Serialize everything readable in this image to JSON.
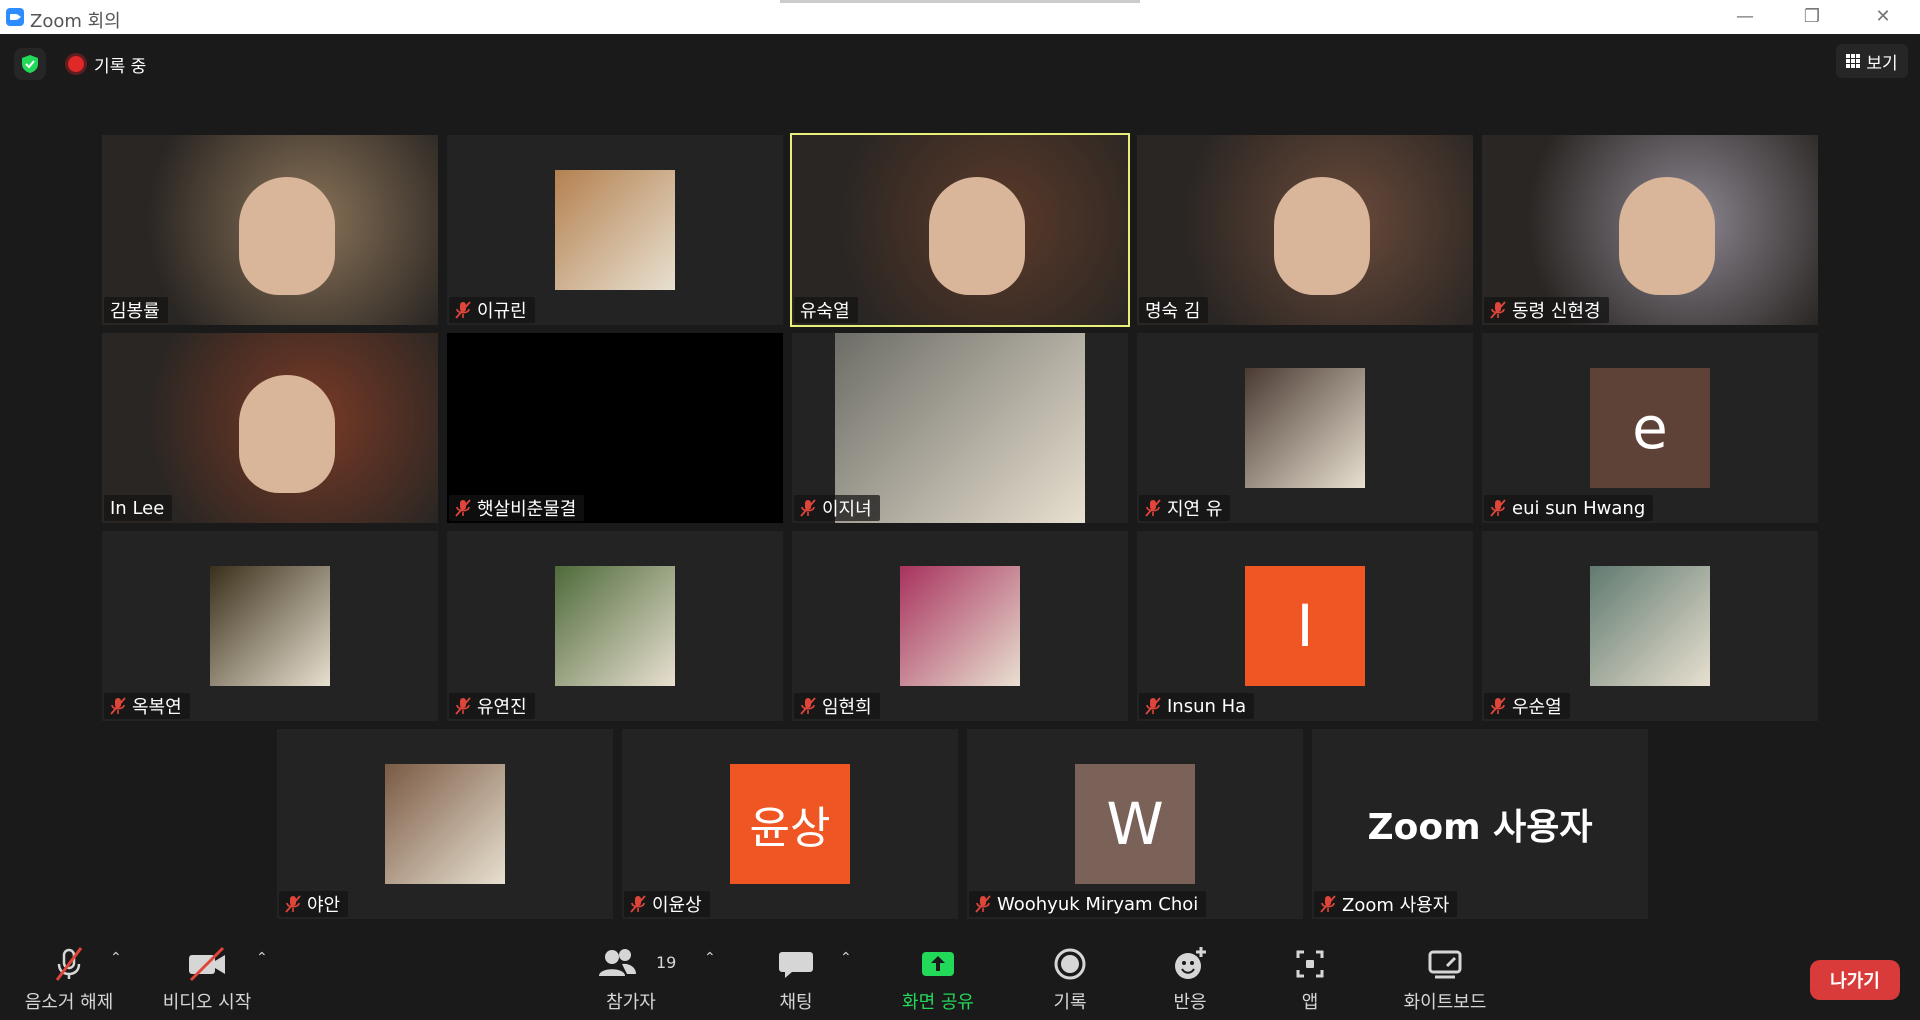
{
  "window": {
    "title": "Zoom 회의"
  },
  "top_bar": {
    "recording_label": "기록 중",
    "view_label": "보기"
  },
  "participants_count": "19",
  "tiles": [
    {
      "name": "김봉률",
      "muted": false,
      "type": "video",
      "color": "#8a7358"
    },
    {
      "name": "이규린",
      "muted": true,
      "type": "image",
      "color": "#b48150"
    },
    {
      "name": "유숙열",
      "muted": false,
      "type": "video",
      "active": true,
      "color": "#5c3a2a"
    },
    {
      "name": "명숙 김",
      "muted": false,
      "type": "video",
      "color": "#6a4a3a"
    },
    {
      "name": "동령 신현경",
      "muted": true,
      "type": "video",
      "color": "#8d8791"
    },
    {
      "name": "In Lee",
      "muted": false,
      "type": "video",
      "color": "#7a3a26"
    },
    {
      "name": "햇살비춘물결",
      "muted": true,
      "type": "black",
      "color": "#000000"
    },
    {
      "name": "이지녀",
      "muted": true,
      "type": "image",
      "color": "#6c6c66"
    },
    {
      "name": "지연 유",
      "muted": true,
      "type": "image",
      "color": "#4a3a32"
    },
    {
      "name": "eui sun Hwang",
      "muted": true,
      "type": "avatar",
      "initial": "e",
      "color": "#5e4237"
    },
    {
      "name": "옥복연",
      "muted": true,
      "type": "image",
      "color": "#3a2f1a"
    },
    {
      "name": "유연진",
      "muted": true,
      "type": "image",
      "color": "#4e6a3a"
    },
    {
      "name": "임현희",
      "muted": true,
      "type": "image",
      "color": "#a8325e"
    },
    {
      "name": "Insun Ha",
      "muted": true,
      "type": "avatar",
      "initial": "I",
      "color": "#f05623"
    },
    {
      "name": "우순열",
      "muted": true,
      "type": "image",
      "color": "#607a70"
    },
    {
      "name": "야안",
      "muted": true,
      "type": "image",
      "color": "#7a5a44"
    },
    {
      "name": "이윤상",
      "muted": true,
      "type": "avatar",
      "initial": "윤상",
      "color": "#f05623"
    },
    {
      "name": "Woohyuk Miryam Choi",
      "muted": true,
      "type": "avatar",
      "initial": "W",
      "color": "#7a6259"
    },
    {
      "name": "Zoom 사용자",
      "muted": true,
      "type": "text",
      "initial": "Zoom 사용자",
      "color": "#232323"
    }
  ],
  "toolbar": {
    "unmute": "음소거 해제",
    "start_video": "비디오 시작",
    "participants": "참가자",
    "chat": "채팅",
    "share_screen": "화면 공유",
    "record": "기록",
    "reactions": "반응",
    "apps": "앱",
    "whiteboard": "화이트보드",
    "leave": "나가기"
  },
  "colors": {
    "accent_green": "#23d959",
    "leave_red": "#d93a3a",
    "active_speaker": "#e8f07a"
  }
}
